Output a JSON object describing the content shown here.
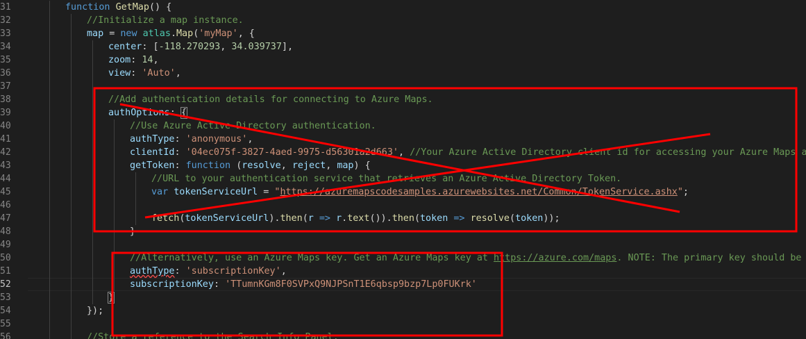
{
  "editor": {
    "active_line": "52",
    "lines": [
      {
        "n": "31",
        "indent": 2,
        "tokens": [
          [
            "kw",
            "function "
          ],
          [
            "fn",
            "GetMap"
          ],
          [
            "p",
            "() {"
          ]
        ]
      },
      {
        "n": "32",
        "indent": 3,
        "tokens": [
          [
            "cm",
            "//Initialize a map instance."
          ]
        ]
      },
      {
        "n": "33",
        "indent": 3,
        "tokens": [
          [
            "var",
            "map"
          ],
          [
            "p",
            " = "
          ],
          [
            "kw",
            "new "
          ],
          [
            "cls",
            "atlas"
          ],
          [
            "p",
            "."
          ],
          [
            "fn",
            "Map"
          ],
          [
            "p",
            "("
          ],
          [
            "str",
            "'myMap'"
          ],
          [
            "p",
            ", {"
          ]
        ]
      },
      {
        "n": "34",
        "indent": 4,
        "tokens": [
          [
            "var",
            "center"
          ],
          [
            "p",
            ": ["
          ],
          [
            "num",
            "-118.270293"
          ],
          [
            "p",
            ", "
          ],
          [
            "num",
            "34.039737"
          ],
          [
            "p",
            "],"
          ]
        ]
      },
      {
        "n": "35",
        "indent": 4,
        "tokens": [
          [
            "var",
            "zoom"
          ],
          [
            "p",
            ": "
          ],
          [
            "num",
            "14"
          ],
          [
            "p",
            ","
          ]
        ]
      },
      {
        "n": "36",
        "indent": 4,
        "tokens": [
          [
            "var",
            "view"
          ],
          [
            "p",
            ": "
          ],
          [
            "str",
            "'Auto'"
          ],
          [
            "p",
            ","
          ]
        ]
      },
      {
        "n": "37",
        "indent": 4,
        "tokens": []
      },
      {
        "n": "38",
        "indent": 4,
        "tokens": [
          [
            "cm",
            "//Add authentication details for connecting to Azure Maps."
          ]
        ]
      },
      {
        "n": "39",
        "indent": 4,
        "tokens": [
          [
            "var",
            "authOptions"
          ],
          [
            "p",
            ": "
          ],
          [
            "bracket",
            "{"
          ]
        ]
      },
      {
        "n": "40",
        "indent": 5,
        "tokens": [
          [
            "cm",
            "//Use Azure Active Directory authentication."
          ]
        ]
      },
      {
        "n": "41",
        "indent": 5,
        "tokens": [
          [
            "var",
            "authType"
          ],
          [
            "p",
            ": "
          ],
          [
            "str",
            "'anonymous'"
          ],
          [
            "p",
            ","
          ]
        ]
      },
      {
        "n": "42",
        "indent": 5,
        "tokens": [
          [
            "var",
            "clientId"
          ],
          [
            "p",
            ": "
          ],
          [
            "str",
            "'04ec075f-3827-4aed-9975-d56301a2d663'"
          ],
          [
            "p",
            ", "
          ],
          [
            "cm",
            "//Your Azure Active Directory client id for accessing your Azure Maps account."
          ]
        ]
      },
      {
        "n": "43",
        "indent": 5,
        "tokens": [
          [
            "var",
            "getToken"
          ],
          [
            "p",
            ": "
          ],
          [
            "kw",
            "function "
          ],
          [
            "p",
            "("
          ],
          [
            "var",
            "resolve"
          ],
          [
            "p",
            ", "
          ],
          [
            "var",
            "reject"
          ],
          [
            "p",
            ", "
          ],
          [
            "var",
            "map"
          ],
          [
            "p",
            ") {"
          ]
        ]
      },
      {
        "n": "44",
        "indent": 6,
        "tokens": [
          [
            "cm",
            "//URL to your authentication service that retrieves an Azure Active Directory Token."
          ]
        ]
      },
      {
        "n": "45",
        "indent": 6,
        "tokens": [
          [
            "kw",
            "var "
          ],
          [
            "var",
            "tokenServiceUrl"
          ],
          [
            "p",
            " = "
          ],
          [
            "str",
            "\""
          ],
          [
            "link",
            "https://azuremapscodesamples.azurewebsites.net/Common/TokenService.ashx"
          ],
          [
            "str",
            "\""
          ],
          [
            "p",
            ";"
          ]
        ]
      },
      {
        "n": "46",
        "indent": 6,
        "tokens": []
      },
      {
        "n": "47",
        "indent": 6,
        "tokens": [
          [
            "fn",
            "fetch"
          ],
          [
            "p",
            "("
          ],
          [
            "var",
            "tokenServiceUrl"
          ],
          [
            "p",
            ")."
          ],
          [
            "fn",
            "then"
          ],
          [
            "p",
            "("
          ],
          [
            "var",
            "r"
          ],
          [
            "p",
            " "
          ],
          [
            "kw",
            "=>"
          ],
          [
            "p",
            " "
          ],
          [
            "var",
            "r"
          ],
          [
            "p",
            "."
          ],
          [
            "fn",
            "text"
          ],
          [
            "p",
            "())."
          ],
          [
            "fn",
            "then"
          ],
          [
            "p",
            "("
          ],
          [
            "var",
            "token"
          ],
          [
            "p",
            " "
          ],
          [
            "kw",
            "=>"
          ],
          [
            "p",
            " "
          ],
          [
            "fn",
            "resolve"
          ],
          [
            "p",
            "("
          ],
          [
            "var",
            "token"
          ],
          [
            "p",
            "));"
          ]
        ]
      },
      {
        "n": "48",
        "indent": 5,
        "tokens": [
          [
            "p",
            "}"
          ]
        ]
      },
      {
        "n": "49",
        "indent": 5,
        "tokens": []
      },
      {
        "n": "50",
        "indent": 5,
        "tokens": [
          [
            "cm",
            "//Alternatively, use an Azure Maps key. Get an Azure Maps key at "
          ],
          [
            "linkc",
            "https://azure.com/maps"
          ],
          [
            "cm",
            ". NOTE: The primary key should be used as the key."
          ]
        ]
      },
      {
        "n": "51",
        "indent": 5,
        "tokens": [
          [
            "squig",
            "authType"
          ],
          [
            "p",
            ": "
          ],
          [
            "str",
            "'subscriptionKey'"
          ],
          [
            "p",
            ","
          ]
        ]
      },
      {
        "n": "52",
        "indent": 5,
        "tokens": [
          [
            "var",
            "subscriptionKey"
          ],
          [
            "p",
            ": "
          ],
          [
            "str",
            "'TTumnKGm8F0SVPxQ9NJPSnT1E6qbsp9bzp7Lp0FUKrk'"
          ]
        ]
      },
      {
        "n": "53",
        "indent": 4,
        "tokens": [
          [
            "bracket",
            "}"
          ]
        ]
      },
      {
        "n": "54",
        "indent": 3,
        "tokens": [
          [
            "p",
            "});"
          ]
        ]
      },
      {
        "n": "55",
        "indent": 3,
        "tokens": []
      },
      {
        "n": "56",
        "indent": 3,
        "tokens": [
          [
            "cm",
            "//Store a reference to the Search Info Panel."
          ]
        ]
      }
    ]
  },
  "annotations": {
    "stroke_color": "#ff0000"
  }
}
